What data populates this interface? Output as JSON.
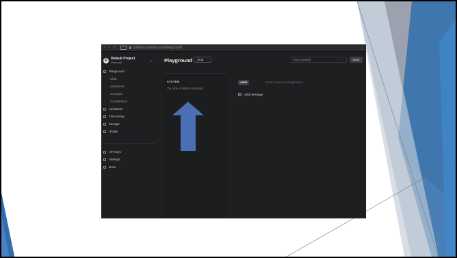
{
  "browser": {
    "nav_glyphs": "‹  ›  C",
    "url": "platform.openai.com/playground",
    "ext_glyph": "⋮"
  },
  "sidebar": {
    "project_avatar": "P",
    "project_name": "Default Project",
    "project_sub": "Personal",
    "project_chevron": "⌄",
    "items": [
      {
        "label": "Playground",
        "icon": "playground-icon"
      },
      {
        "label": "Chat",
        "sub": true
      },
      {
        "label": "Assistants",
        "sub": true
      },
      {
        "label": "Compare",
        "sub": true
      },
      {
        "label": "Completions",
        "sub": true
      },
      {
        "label": "Assistants",
        "icon": "assistants-icon"
      },
      {
        "label": "Fine-tuning",
        "icon": "fine-tuning-icon"
      },
      {
        "label": "Storage",
        "icon": "storage-icon"
      },
      {
        "label": "Usage",
        "icon": "usage-icon"
      },
      {
        "label": "API keys",
        "icon": "key-icon"
      },
      {
        "label": "Settings",
        "icon": "gear-icon"
      },
      {
        "label": "Docs",
        "icon": "docs-icon"
      }
    ]
  },
  "main": {
    "title": "Playground",
    "mode": "Chat",
    "mode_chevron": "⌃",
    "presets_placeholder": "Your presets",
    "presets_chevron": "⌃",
    "save_label": "Save",
    "system_label": "SYSTEM",
    "system_text": "You are a helpful assistant.",
    "user_badge": "USER",
    "user_placeholder": "Enter a user message here.",
    "plus_glyph": "+",
    "add_message": "Add message"
  },
  "colors": {
    "app_bg": "#1e1f21",
    "arrow": "#4a6fb5",
    "deco_blue": "#2f6fae",
    "deco_gray": "#8f96a6"
  }
}
